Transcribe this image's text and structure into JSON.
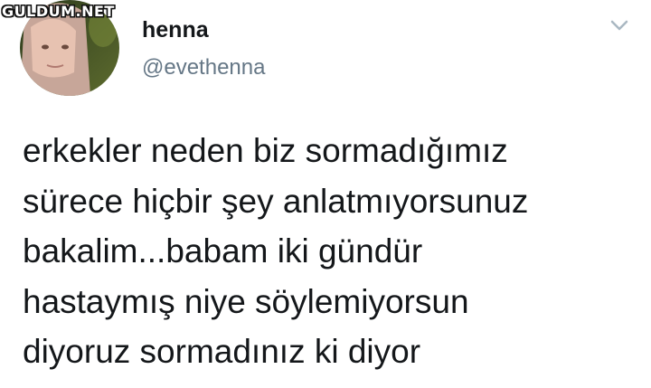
{
  "watermark": "GULDUM.NET",
  "user": {
    "display_name": "henna",
    "handle": "@evethenna"
  },
  "menu": {
    "icon": "chevron-down-icon"
  },
  "tweet": {
    "lines": [
      "erkekler neden biz sormadığımız",
      "sürece hiçbir şey anlatmıyorsunuz",
      "bakalim...babam iki gündür",
      "hastaymış niye söylemiyorsun",
      "diyoruz sormadınız ki diyor"
    ]
  },
  "colors": {
    "text": "#14171a",
    "handle": "#657786",
    "chevron": "#aab8c2"
  }
}
